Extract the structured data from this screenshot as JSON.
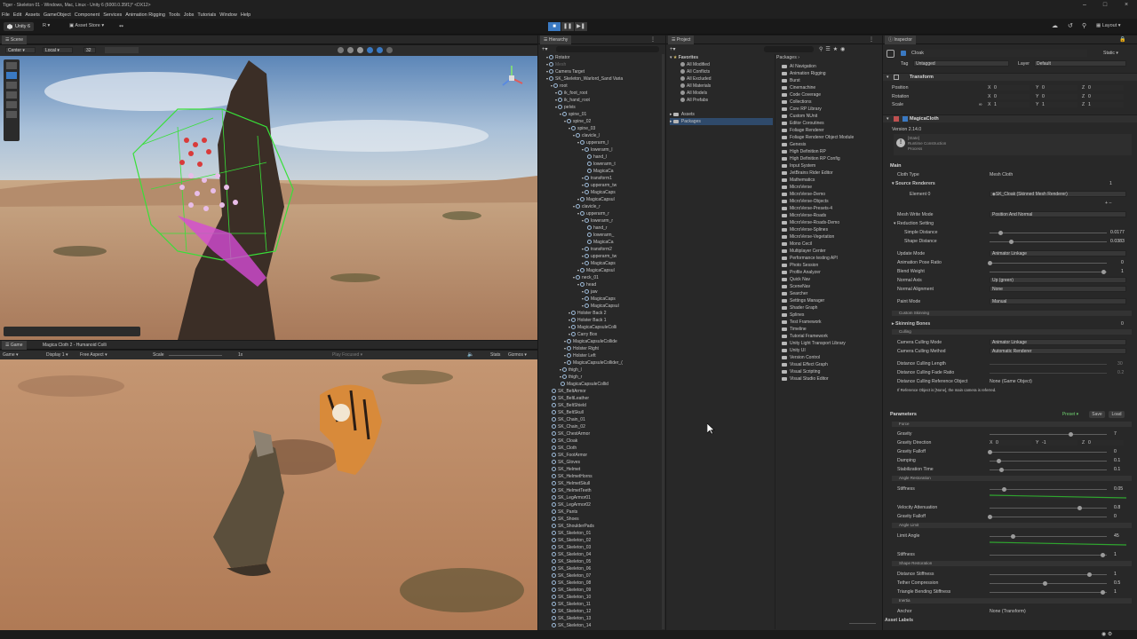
{
  "window": {
    "title": "Tiger - Skeleton 01 - Windows, Mac, Linux - Unity 6 (6000.0.35f1)* <DX12>"
  },
  "menu": [
    "File",
    "Edit",
    "Assets",
    "GameObject",
    "Component",
    "Services",
    "Animation Rigging",
    "Tools",
    "Jobs",
    "Tutorials",
    "Window",
    "Help"
  ],
  "toolbar": {
    "account": "Unity 6",
    "r": "R",
    "asset_store": "Asset Store",
    "layout": "Layout"
  },
  "scene": {
    "tab": "Scene",
    "pivot": "Center",
    "space": "Local",
    "grid": "32"
  },
  "game": {
    "tab": "Game",
    "title": "Magica Cloth 2 - Humanoid Colli",
    "mode": "Game",
    "display": "Display 1",
    "aspect": "Free Aspect",
    "scale_label": "Scale",
    "scale": "1x",
    "play": "Play Focused",
    "stats": "Stats",
    "gizmos": "Gizmos"
  },
  "hierarchy": {
    "tab": "Hierarchy",
    "items": [
      {
        "name": "Rotator",
        "d": 1
      },
      {
        "name": "Mesh",
        "d": 1
      },
      {
        "name": "Camera Target",
        "d": 1
      },
      {
        "name": "SK_Skeleton_Warlord_Sand Varia",
        "d": 1
      },
      {
        "name": "root",
        "d": 2
      },
      {
        "name": "ik_foot_root",
        "d": 3
      },
      {
        "name": "ik_hand_root",
        "d": 3
      },
      {
        "name": "pelvis",
        "d": 3
      },
      {
        "name": "spine_01",
        "d": 4
      },
      {
        "name": "spine_02",
        "d": 5
      },
      {
        "name": "spine_03",
        "d": 6
      },
      {
        "name": "clavicle_l",
        "d": 7
      },
      {
        "name": "upperarm_l",
        "d": 8
      },
      {
        "name": "lowerarm_l",
        "d": 9
      },
      {
        "name": "hand_l",
        "d": 10
      },
      {
        "name": "lowerarm_t",
        "d": 10
      },
      {
        "name": "MagicaCa",
        "d": 10
      },
      {
        "name": "transform1",
        "d": 9
      },
      {
        "name": "upperarm_tw",
        "d": 9
      },
      {
        "name": "MagicaCaps",
        "d": 9
      },
      {
        "name": "MagicaCapsul",
        "d": 8
      },
      {
        "name": "clavicle_r",
        "d": 7
      },
      {
        "name": "upperarm_r",
        "d": 8
      },
      {
        "name": "lowerarm_r",
        "d": 9
      },
      {
        "name": "hand_r",
        "d": 10
      },
      {
        "name": "lowerarm_",
        "d": 10
      },
      {
        "name": "MagicaCa",
        "d": 10
      },
      {
        "name": "transform2",
        "d": 9
      },
      {
        "name": "upperarm_tw",
        "d": 9
      },
      {
        "name": "MagicaCaps",
        "d": 9
      },
      {
        "name": "MagicaCapsul",
        "d": 8
      },
      {
        "name": "neck_01",
        "d": 7
      },
      {
        "name": "head",
        "d": 8
      },
      {
        "name": "jaw",
        "d": 9
      },
      {
        "name": "MagicaCaps",
        "d": 9
      },
      {
        "name": "MagicaCapsul",
        "d": 9
      },
      {
        "name": "Holster Back 2",
        "d": 6
      },
      {
        "name": "Holster Back 1",
        "d": 6
      },
      {
        "name": "MagicaCapsuleColli",
        "d": 6
      },
      {
        "name": "Carry Box",
        "d": 6
      },
      {
        "name": "MagicaCapsuleCollide",
        "d": 5
      },
      {
        "name": "Holster Right",
        "d": 5
      },
      {
        "name": "Holster Left",
        "d": 5
      },
      {
        "name": "MagicaCapsuleCollider_(",
        "d": 5
      },
      {
        "name": "thigh_l",
        "d": 4
      },
      {
        "name": "thigh_r",
        "d": 4
      },
      {
        "name": "MagicaCapsuleCollid",
        "d": 4
      },
      {
        "name": "SK_BeltArmor",
        "d": 2
      },
      {
        "name": "SK_BeltLeather",
        "d": 2
      },
      {
        "name": "SK_BeltShield",
        "d": 2
      },
      {
        "name": "SK_BeltSkull",
        "d": 2
      },
      {
        "name": "SK_Chain_01",
        "d": 2
      },
      {
        "name": "SK_Chain_02",
        "d": 2
      },
      {
        "name": "SK_ChestArmor",
        "d": 2
      },
      {
        "name": "SK_Cloak",
        "d": 2
      },
      {
        "name": "SK_Cloth",
        "d": 2
      },
      {
        "name": "SK_FootArmor",
        "d": 2
      },
      {
        "name": "SK_Gloves",
        "d": 2
      },
      {
        "name": "SK_Helmet",
        "d": 2
      },
      {
        "name": "SK_HelmetHorns",
        "d": 2
      },
      {
        "name": "SK_HelmetSkull",
        "d": 2
      },
      {
        "name": "SK_HelmetTeeth",
        "d": 2
      },
      {
        "name": "SK_LegArmor01",
        "d": 2
      },
      {
        "name": "SK_LegArmor02",
        "d": 2
      },
      {
        "name": "SK_Pants",
        "d": 2
      },
      {
        "name": "SK_Shoes",
        "d": 2
      },
      {
        "name": "SK_ShoulderPads",
        "d": 2
      },
      {
        "name": "SK_Skeleton_01",
        "d": 2
      },
      {
        "name": "SK_Skeleton_02",
        "d": 2
      },
      {
        "name": "SK_Skeleton_03",
        "d": 2
      },
      {
        "name": "SK_Skeleton_04",
        "d": 2
      },
      {
        "name": "SK_Skeleton_05",
        "d": 2
      },
      {
        "name": "SK_Skeleton_06",
        "d": 2
      },
      {
        "name": "SK_Skeleton_07",
        "d": 2
      },
      {
        "name": "SK_Skeleton_08",
        "d": 2
      },
      {
        "name": "SK_Skeleton_09",
        "d": 2
      },
      {
        "name": "SK_Skeleton_10",
        "d": 2
      },
      {
        "name": "SK_Skeleton_11",
        "d": 2
      },
      {
        "name": "SK_Skeleton_12",
        "d": 2
      },
      {
        "name": "SK_Skeleton_13",
        "d": 2
      },
      {
        "name": "SK_Skeleton_14",
        "d": 2
      },
      {
        "name": "SK_Skull_Lower",
        "d": 2
      }
    ]
  },
  "project": {
    "tab": "Project",
    "favorites_label": "Favorites",
    "favorites": [
      "All Modified",
      "All Conflicts",
      "All Excluded",
      "All Materials",
      "All Models",
      "All Prefabs"
    ],
    "roots": [
      "Assets",
      "Packages"
    ],
    "breadcrumb": "Packages",
    "packages": [
      "AI Navigation",
      "Animation Rigging",
      "Burst",
      "Cinemachine",
      "Code Coverage",
      "Collections",
      "Core RP Library",
      "Custom NUnit",
      "Editor Coroutines",
      "Foliage Renderer",
      "Foliage Renderer Object Module",
      "Genesis",
      "High Definition RP",
      "High Definition RP Config",
      "Input System",
      "JetBrains Rider Editor",
      "Mathematics",
      "MicroVerse",
      "MicroVerse-Demo",
      "MicroVerse-Objects",
      "MicroVerse-Presets-4",
      "MicroVerse-Roads",
      "MicroVerse-Roads-Demo",
      "MicroVerse-Splines",
      "MicroVerse-Vegetation",
      "Mono Cecil",
      "Multiplayer Center",
      "Performance testing API",
      "Photo Session",
      "Profile Analyzer",
      "Quick Nav",
      "SceneNav",
      "Searcher",
      "Settings Manager",
      "Shader Graph",
      "Splines",
      "Test Framework",
      "Timeline",
      "Tutorial Framework",
      "Unity Light Transport Library",
      "Unity UI",
      "Version Control",
      "Visual Effect Graph",
      "Visual Scripting",
      "Visual Studio Editor"
    ]
  },
  "inspector": {
    "tab": "Inspector",
    "object_name": "Cloak",
    "static": "Static",
    "tag_label": "Tag",
    "tag": "Untagged",
    "layer_label": "Layer",
    "layer": "Default",
    "transform": {
      "title": "Transform",
      "position": "Position",
      "rotation": "Rotation",
      "scale": "Scale",
      "pos": [
        "0",
        "0",
        "0"
      ],
      "rot": [
        "0",
        "0",
        "0"
      ],
      "scl": [
        "1",
        "1",
        "1"
      ]
    },
    "magica": {
      "title": "MagicaCloth",
      "version": "Version 2.14.0",
      "info1": "[State]",
      "info2": "Runtime Construction",
      "info3": "Process",
      "main": "Main",
      "cloth_type_label": "Cloth Type",
      "cloth_type": "Mesh Cloth",
      "source_renderers": "Source Renderers",
      "src_count": "1",
      "element0_label": "Element 0",
      "element0": "SK_Cloak (Skinned Mesh Renderer)",
      "mesh_write_label": "Mesh Write Mode",
      "mesh_write": "Position And Normal",
      "reduction": "Reduction Setting",
      "simple_label": "Simple Distance",
      "simple": "0.0177",
      "shape_label": "Shape Distance",
      "shape": "0.0383",
      "update_label": "Update Mode",
      "update": "Animator Linkage",
      "anim_blend_label": "Animation Pose Ratio",
      "anim_blend": "0",
      "blend_label": "Blend Weight",
      "blend": "1",
      "normal_axis_label": "Normal Axis",
      "normal_axis": "Up (green)",
      "normal_align_label": "Normal Alignment",
      "normal_align": "None",
      "paint_label": "Paint Mode",
      "paint": "Manual",
      "custom_skinning": "Custom Skinning",
      "skinning_bones": "Skinning Bones",
      "skinning_count": "0",
      "culling": "Culling",
      "cam_culling_mode_label": "Camera Culling Mode",
      "cam_culling_mode": "Animator Linkage",
      "cam_culling_method_label": "Camera Culling Method",
      "cam_culling_method": "Automatic Renderer",
      "dist_length": "Distance Culling Length",
      "dist_length_v": "30",
      "dist_fade": "Distance Culling Fade Ratio",
      "dist_fade_v": "0.2",
      "dist_ref": "Distance Culling Reference Object",
      "dist_ref_v": "None (Game Object)",
      "ref_note": "If Reference Object is [None], the main camera is referred."
    },
    "params": {
      "title": "Parameters",
      "preset": "Preset",
      "save": "Save",
      "load": "Load",
      "force": "Force",
      "gravity_label": "Gravity",
      "gravity": "7",
      "gdir_label": "Gravity Direction",
      "gdir": [
        "0",
        "-1",
        "0"
      ],
      "gfall_label": "Gravity Falloff",
      "gfall": "0",
      "damp_label": "Damping",
      "damp": "0.1",
      "stab_label": "Stabilization Time",
      "stab": "0.1",
      "angle_rest": "Angle Restoration",
      "stiff_label": "Stiffness",
      "stiff": "0.05",
      "vel_label": "Velocity Attenuation",
      "vel": "0.8",
      "gfall2_label": "Gravity Falloff",
      "gfall2": "0",
      "angle_limit": "Angle Limit",
      "limit_label": "Limit Angle",
      "limit": "45",
      "stiff2_label": "Stiffness",
      "stiff2": "1",
      "shape_rest": "Shape Restoration",
      "dist_stiff_label": "Distance Stiffness",
      "dist_stiff": "1",
      "tether_label": "Tether Compression",
      "tether": "0.5",
      "tri_label": "Triangle Bending Stiffness",
      "tri": "1",
      "inertia": "Inertia",
      "anchor_label": "Anchor",
      "anchor": "None (Transform)"
    },
    "asset_labels": "Asset Labels"
  }
}
